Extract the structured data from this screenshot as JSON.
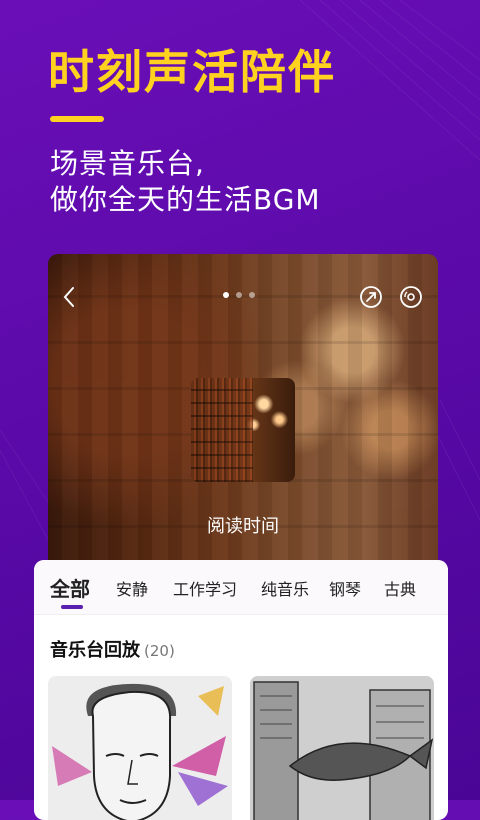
{
  "promo": {
    "headline": "时刻声活陪伴",
    "subline1": "场景音乐台,",
    "subline2": "做你全天的生活BGM"
  },
  "player": {
    "page_dots": 3,
    "active_dot": 0,
    "station_title": "阅读时间",
    "icons": [
      "back-arrow-icon",
      "share-icon",
      "disc-icon"
    ]
  },
  "tabs": {
    "items": [
      "全部",
      "安静",
      "工作学习",
      "纯音乐",
      "钢琴",
      "古典"
    ],
    "active": "全部"
  },
  "section": {
    "title": "音乐台回放",
    "count": "(20)"
  },
  "colors": {
    "accent_yellow": "#ffd21f",
    "background_purple": "#5b0aa9",
    "tab_indicator": "#5b1fb0"
  }
}
